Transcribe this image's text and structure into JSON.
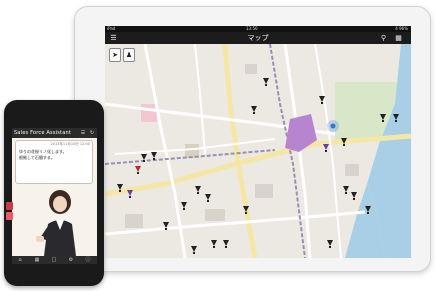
{
  "tablet": {
    "status_bar": {
      "carrier": "iPad",
      "time": "13:50",
      "battery": "4 96%"
    },
    "nav": {
      "title": "マップ",
      "menu_icon": "hamburger-menu-icon",
      "search_icon": "search-icon",
      "list_icon": "list-icon"
    },
    "map_tools": {
      "navigate_icon": "navigation-arrow-icon",
      "person_icon": "person-icon"
    },
    "accent_color": "#6b3fa0"
  },
  "phone": {
    "app_title": "Sales Force Assistant",
    "chat": {
      "time": "2013年11月10日 12:00",
      "lines": [
        "ゆりの花桜リノ化します。",
        "根拠して石間する。"
      ]
    },
    "side_buttons": [
      "red-bookmark-icon",
      "heart-icon"
    ],
    "tabs": [
      "home-icon",
      "calendar-icon",
      "document-icon",
      "gear-icon",
      "info-icon"
    ]
  }
}
